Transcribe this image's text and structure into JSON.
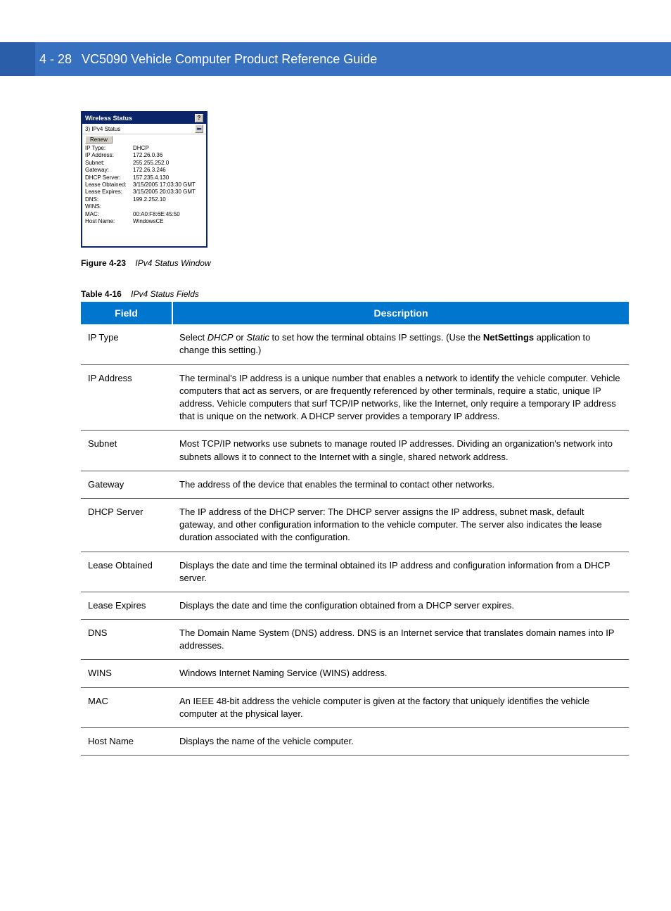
{
  "header": {
    "page_number": "4 - 28",
    "title": "VC5090 Vehicle Computer Product Reference Guide"
  },
  "wireless_status_window": {
    "title": "Wireless Status",
    "help_btn": "?",
    "sub_title": "3) IPv4 Status",
    "renew_button": "Renew",
    "rows": [
      {
        "label": "IP Type:",
        "value": "DHCP"
      },
      {
        "label": "IP Address:",
        "value": "172.26.0.36"
      },
      {
        "label": "Subnet:",
        "value": "255.255.252.0"
      },
      {
        "label": "Gateway:",
        "value": "172.26.3.246"
      },
      {
        "label": "DHCP Server:",
        "value": "157.235.4.130"
      },
      {
        "label": "Lease Obtained:",
        "value": "3/15/2005 17:03:30 GMT"
      },
      {
        "label": "Lease Expires:",
        "value": "3/15/2005 20:03:30 GMT"
      },
      {
        "label": "DNS:",
        "value": "199.2.252.10"
      },
      {
        "label": "WINS:",
        "value": ""
      },
      {
        "label": "MAC:",
        "value": "00:A0:F8:6E:45:50"
      },
      {
        "label": "Host Name:",
        "value": "WindowsCE"
      }
    ]
  },
  "figure_caption": {
    "label": "Figure 4-23",
    "text": "IPv4 Status Window"
  },
  "table_caption": {
    "label": "Table 4-16",
    "text": "IPv4 Status Fields"
  },
  "table": {
    "headers": {
      "field": "Field",
      "description": "Description"
    },
    "rows": [
      {
        "field": "IP Type",
        "description_parts": [
          {
            "text": "Select ",
            "style": ""
          },
          {
            "text": "DHCP",
            "style": "italic"
          },
          {
            "text": " or ",
            "style": ""
          },
          {
            "text": "Static",
            "style": "italic"
          },
          {
            "text": " to set how the terminal obtains IP settings. (Use the ",
            "style": ""
          },
          {
            "text": "NetSettings",
            "style": "bold"
          },
          {
            "text": " application to change this setting.)",
            "style": ""
          }
        ]
      },
      {
        "field": "IP Address",
        "description_parts": [
          {
            "text": "The terminal's IP address is a unique number that enables a network to identify the vehicle computer. Vehicle computers that act as servers, or are frequently referenced by other terminals, require a static, unique IP address. Vehicle computers that surf TCP/IP networks, like the Internet, only require a temporary IP address that is unique on the network. A DHCP server provides a temporary IP address.",
            "style": ""
          }
        ]
      },
      {
        "field": "Subnet",
        "description_parts": [
          {
            "text": "Most TCP/IP networks use subnets to manage routed IP addresses. Dividing an organization's network into subnets allows it to connect to the Internet with a single, shared network address.",
            "style": ""
          }
        ]
      },
      {
        "field": "Gateway",
        "description_parts": [
          {
            "text": "The address of the device that enables the terminal to contact other networks.",
            "style": ""
          }
        ]
      },
      {
        "field": "DHCP Server",
        "description_parts": [
          {
            "text": "The IP address of the DHCP server: The DHCP server assigns the IP address, subnet mask, default gateway, and other configuration information to the vehicle computer. The server also indicates the lease duration associated with the configuration.",
            "style": ""
          }
        ]
      },
      {
        "field": "Lease Obtained",
        "description_parts": [
          {
            "text": "Displays the date and time the terminal obtained its IP address and configuration information from a DHCP server.",
            "style": ""
          }
        ]
      },
      {
        "field": "Lease Expires",
        "description_parts": [
          {
            "text": "Displays the date and time the configuration obtained from a DHCP server expires.",
            "style": ""
          }
        ]
      },
      {
        "field": "DNS",
        "description_parts": [
          {
            "text": "The Domain Name System (DNS) address. DNS is an Internet service that translates domain names into IP addresses.",
            "style": ""
          }
        ]
      },
      {
        "field": "WINS",
        "description_parts": [
          {
            "text": "Windows Internet Naming Service (WINS) address.",
            "style": ""
          }
        ]
      },
      {
        "field": "MAC",
        "description_parts": [
          {
            "text": "An IEEE 48-bit address the vehicle computer is given at the factory that uniquely identifies the vehicle computer at the physical layer.",
            "style": ""
          }
        ]
      },
      {
        "field": "Host Name",
        "description_parts": [
          {
            "text": "Displays the name of the vehicle computer.",
            "style": ""
          }
        ]
      }
    ]
  }
}
